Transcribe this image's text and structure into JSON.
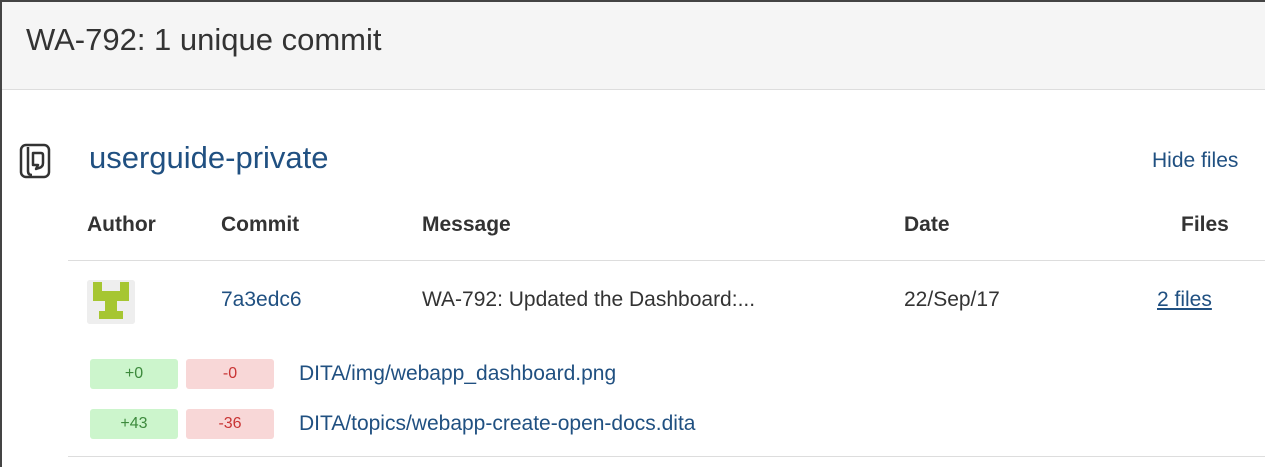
{
  "dialog": {
    "title": "WA-792: 1 unique commit"
  },
  "repository": {
    "icon": "repository-icon",
    "name": "userguide-private",
    "toggle_label": "Hide files"
  },
  "table": {
    "headers": {
      "author": "Author",
      "commit": "Commit",
      "message": "Message",
      "date": "Date",
      "files": "Files"
    },
    "rows": [
      {
        "avatar_icon": "author-avatar",
        "commit": "7a3edc6",
        "message": "WA-792: Updated the Dashboard:...",
        "date": "22/Sep/17",
        "files": "2 files"
      }
    ]
  },
  "file_changes": [
    {
      "added": "+0",
      "removed": "-0",
      "path": "DITA/img/webapp_dashboard.png"
    },
    {
      "added": "+43",
      "removed": "-36",
      "path": "DITA/topics/webapp-create-open-docs.dita"
    }
  ],
  "colors": {
    "link": "#205081",
    "added_bg": "#ccf5cc",
    "removed_bg": "#f8d7d7",
    "avatar_green": "#a6c632"
  }
}
